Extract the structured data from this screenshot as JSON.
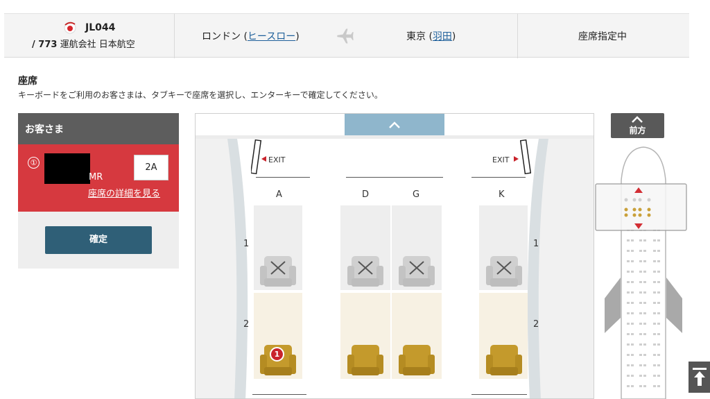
{
  "flight": {
    "number": "JL044",
    "aircraft": "/ 773",
    "operated_by": "運航会社 日本航空",
    "origin_label": "ロンドン",
    "origin_airport": "ヒースロー",
    "destination_label": "東京",
    "destination_airport": "羽田",
    "status": "座席指定中"
  },
  "section": {
    "title": "座席",
    "description": "キーボードをご利用のお客さまは、タブキーで座席を選択し、エンターキーで確定してください。"
  },
  "passengers": {
    "header": "お客さま",
    "items": [
      {
        "number": "①",
        "title": "MR",
        "seat": "2A",
        "details_link": "座席の詳細を見る"
      }
    ],
    "confirm_label": "確定"
  },
  "seat_map": {
    "exit_label": "EXIT",
    "columns": [
      "A",
      "D",
      "G",
      "K"
    ],
    "rows": [
      {
        "number": "1",
        "seats": [
          {
            "column": "A",
            "status": "unavailable"
          },
          {
            "column": "D",
            "status": "unavailable"
          },
          {
            "column": "G",
            "status": "unavailable"
          },
          {
            "column": "K",
            "status": "unavailable"
          }
        ]
      },
      {
        "number": "2",
        "seats": [
          {
            "column": "A",
            "status": "selected",
            "passenger_badge": "1"
          },
          {
            "column": "D",
            "status": "available"
          },
          {
            "column": "G",
            "status": "available"
          },
          {
            "column": "K",
            "status": "available"
          }
        ]
      }
    ],
    "colors": {
      "available": "#c49a2c",
      "unavailable": "#c9c9c9",
      "selected_badge": "#c9242c",
      "first_class_row_bg": "#f7f1e3",
      "blocked_row_bg": "#eeeeee"
    }
  },
  "mini_map": {
    "front_label": "前方",
    "scroll_up_icon": "chevron-up-icon",
    "scroll_to_top_icon": "arrow-to-top-icon"
  }
}
